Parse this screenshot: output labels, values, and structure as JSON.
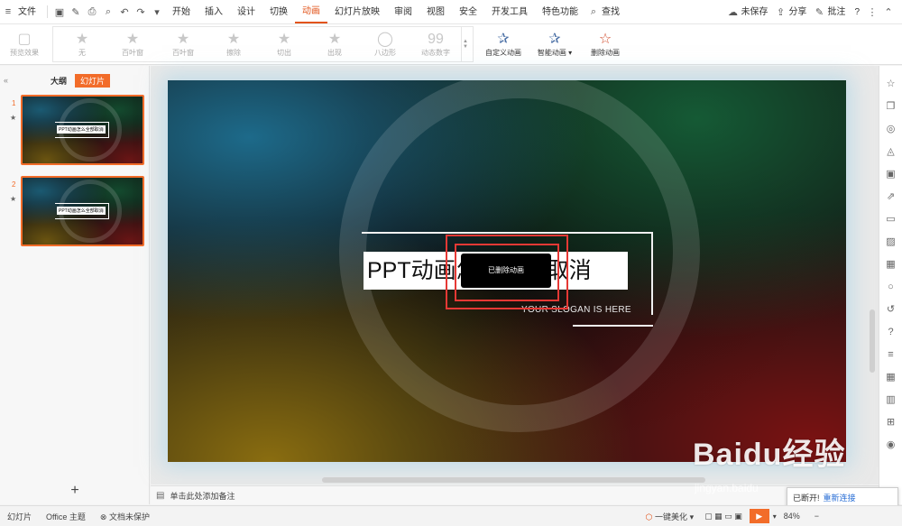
{
  "menubar": {
    "file_label": "文件",
    "tabs": [
      "开始",
      "插入",
      "设计",
      "切换",
      "动画",
      "幻灯片放映",
      "审阅",
      "视图",
      "安全",
      "开发工具",
      "特色功能"
    ],
    "active_tab": "动画",
    "search_label": "查找",
    "unsaved_label": "未保存",
    "share_label": "分享",
    "comment_label": "批注",
    "help_label": "?"
  },
  "ribbon": {
    "preview_label": "预览效果",
    "effects": [
      {
        "label": "无",
        "icon": "star-icon"
      },
      {
        "label": "百叶窗",
        "icon": "blinds-icon"
      },
      {
        "label": "百叶窗",
        "icon": "blinds-icon"
      },
      {
        "label": "擦除",
        "icon": "wipe-icon"
      },
      {
        "label": "切出",
        "icon": "star-icon"
      },
      {
        "label": "出现",
        "icon": "star-icon"
      },
      {
        "label": "八边形",
        "icon": "octagon-icon"
      },
      {
        "label": "动态数字",
        "icon": "number-icon"
      }
    ],
    "custom_animation_label": "自定义动画",
    "smart_animation_label": "智能动画",
    "delete_animation_label": "删除动画"
  },
  "leftpanel": {
    "outline_tab": "大纲",
    "slides_tab": "幻灯片",
    "thumbnails": [
      {
        "num": "1",
        "title": "PPT动画怎么全部取消"
      },
      {
        "num": "2",
        "title": "PPT动画怎么全部取消"
      }
    ],
    "add_label": "+"
  },
  "slide": {
    "title": "PPT动画怎么全部取消",
    "slogan": "YOUR SLOGAN IS HERE",
    "toast": "已删除动画"
  },
  "notes": {
    "placeholder": "单击此处添加备注"
  },
  "status": {
    "slide_label": "幻灯片",
    "theme_label": "Office 主题",
    "protect_label": "文档未保护",
    "beautify_label": "一键美化",
    "zoom": "84%"
  },
  "connection": {
    "text": "已断开!",
    "link": "重新连接"
  },
  "watermark": {
    "main": "Baidu经验",
    "sub": "jingyan.baidu"
  }
}
